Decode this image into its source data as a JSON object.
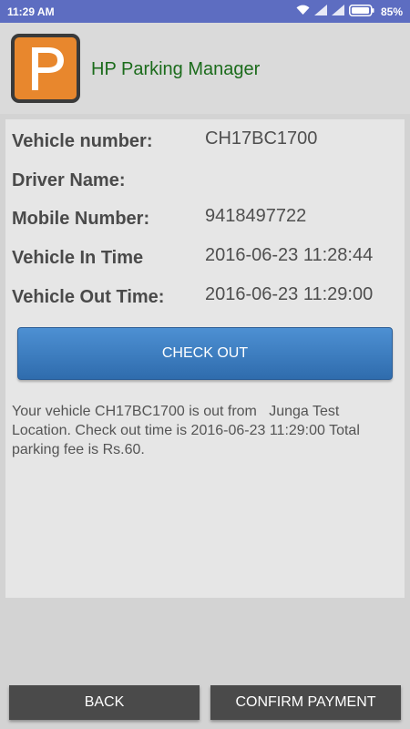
{
  "status_bar": {
    "time": "11:29 AM",
    "battery": "85%",
    "icons": [
      "wifi-icon",
      "signal-icon",
      "signal-icon",
      "battery-icon"
    ]
  },
  "header": {
    "title": "HP Parking Manager",
    "logo_letter": "P",
    "title_color": "#1b6b1b",
    "logo_color": "#e8872d"
  },
  "details": {
    "vehicle_number_label": "Vehicle number:",
    "vehicle_number_value": "CH17BC1700",
    "driver_name_label": "Driver Name:",
    "driver_name_value": "",
    "mobile_number_label": "Mobile Number:",
    "mobile_number_value": "9418497722",
    "in_time_label": "Vehicle In Time",
    "in_time_value": "2016-06-23 11:28:44",
    "out_time_label": "Vehicle Out Time:",
    "out_time_value": "2016-06-23 11:29:00"
  },
  "checkout": {
    "label": "CHECK OUT",
    "color": "#3b7dc1"
  },
  "message": "Your vehicle CH17BC1700 is out from   Junga Test Location. Check out time is 2016-06-23 11:29:00 Total parking fee is Rs.60.",
  "footer": {
    "back_label": "BACK",
    "confirm_label": "CONFIRM PAYMENT"
  }
}
